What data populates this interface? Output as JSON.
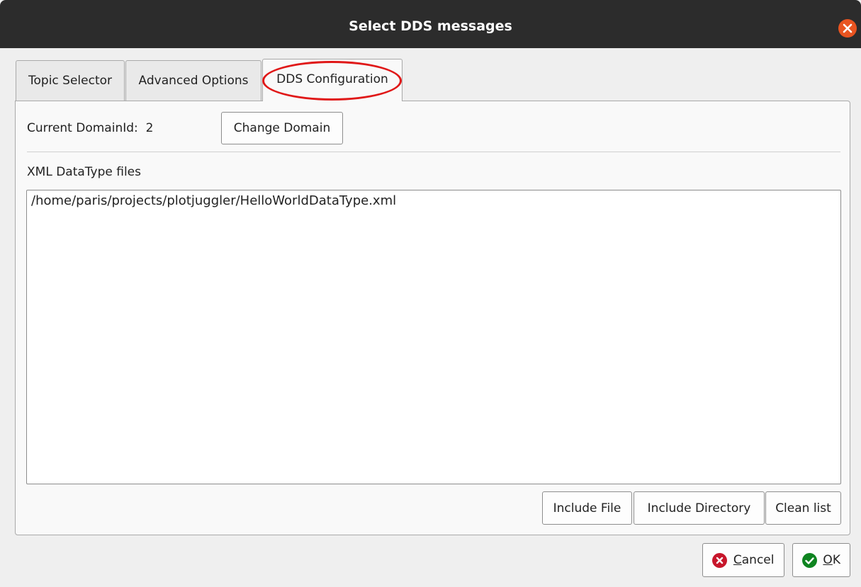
{
  "window": {
    "title": "Select DDS messages"
  },
  "tabs": [
    {
      "label": "Topic Selector"
    },
    {
      "label": "Advanced Options"
    },
    {
      "label": "DDS Configuration",
      "active": true
    }
  ],
  "domain": {
    "label": "Current DomainId:",
    "value": "2",
    "change_button": "Change Domain"
  },
  "xml": {
    "label": "XML DataType files",
    "files": [
      "/home/paris/projects/plotjuggler/HelloWorldDataType.xml"
    ],
    "include_file": "Include File",
    "include_directory": "Include Directory",
    "clean_list": "Clean list"
  },
  "dialog_buttons": {
    "cancel": {
      "mnemonic": "C",
      "rest": "ancel"
    },
    "ok": {
      "mnemonic": "O",
      "rest": "K"
    }
  },
  "colors": {
    "titlebar": "#2c2c2c",
    "close": "#e95420",
    "highlight": "#e01818",
    "cancel_icon": "#c7162b",
    "ok_icon": "#0e8420"
  },
  "icons": [
    "close-icon",
    "cancel-icon",
    "ok-icon"
  ]
}
